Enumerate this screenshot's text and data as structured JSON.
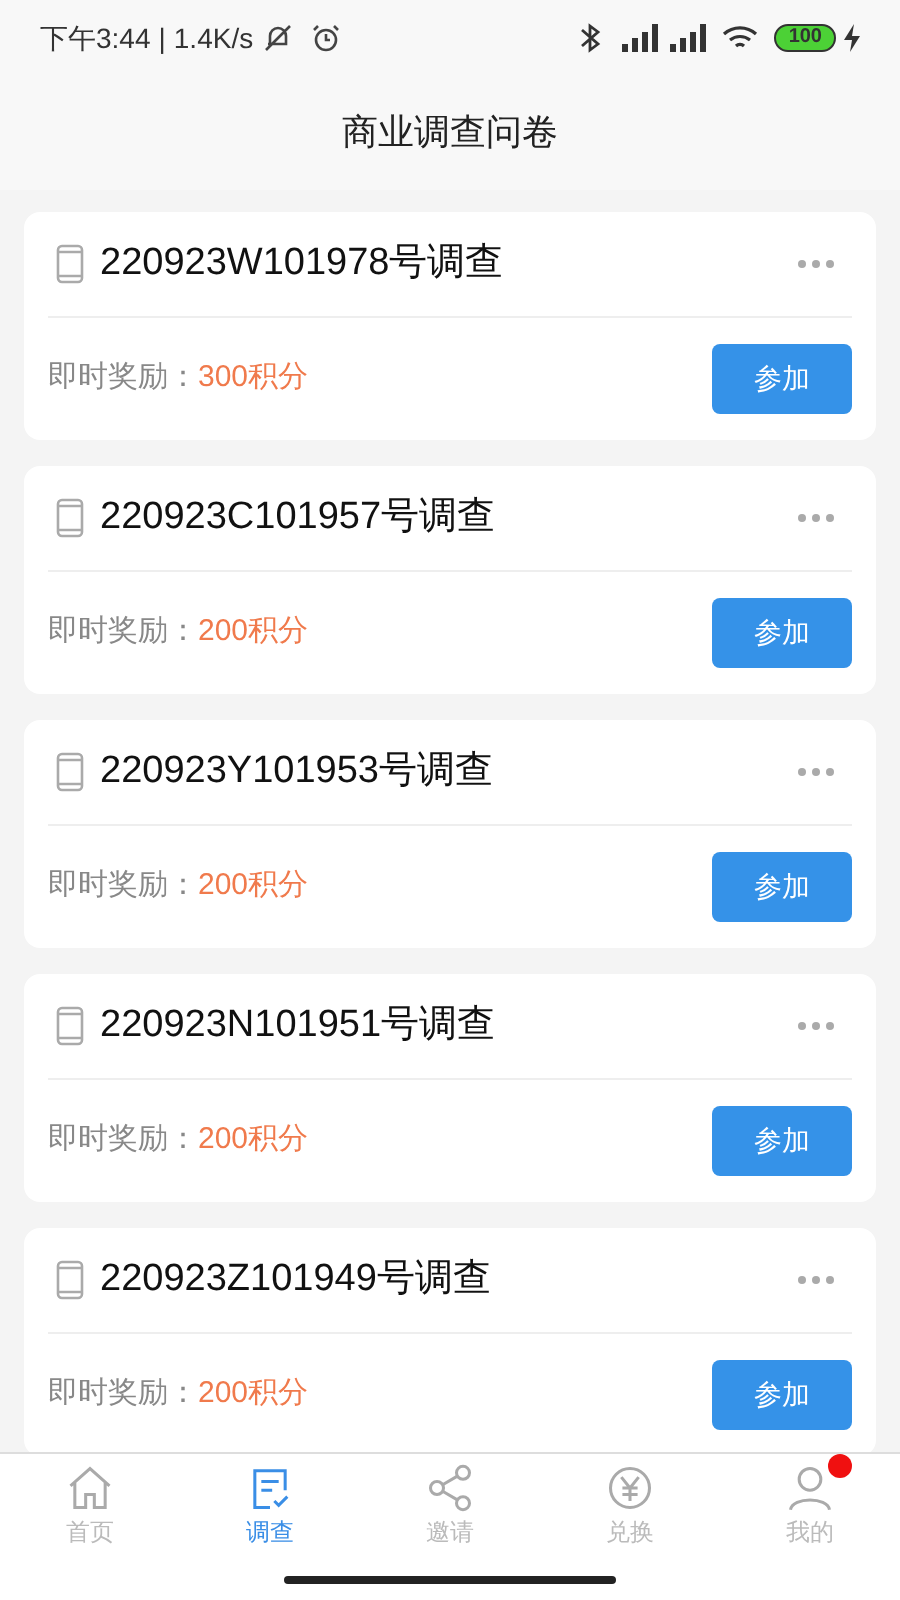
{
  "status_bar": {
    "time": "下午3:44",
    "separator": "|",
    "speed": "1.4K/s",
    "battery": "100"
  },
  "header": {
    "title": "商业调查问卷"
  },
  "surveys": [
    {
      "title": "220923W101978号调查",
      "reward_label": "即时奖励：",
      "reward": "300积分",
      "action": "参加"
    },
    {
      "title": "220923C101957号调查",
      "reward_label": "即时奖励：",
      "reward": "200积分",
      "action": "参加"
    },
    {
      "title": "220923Y101953号调查",
      "reward_label": "即时奖励：",
      "reward": "200积分",
      "action": "参加"
    },
    {
      "title": "220923N101951号调查",
      "reward_label": "即时奖励：",
      "reward": "200积分",
      "action": "参加"
    },
    {
      "title": "220923Z101949号调查",
      "reward_label": "即时奖励：",
      "reward": "200积分",
      "action": "参加"
    }
  ],
  "tab_bar": [
    {
      "label": "首页",
      "kind": "home",
      "selected": false,
      "dot": false
    },
    {
      "label": "调查",
      "kind": "survey",
      "selected": true,
      "dot": false
    },
    {
      "label": "邀请",
      "kind": "share",
      "selected": false,
      "dot": false
    },
    {
      "label": "兑换",
      "kind": "exchange",
      "selected": false,
      "dot": false
    },
    {
      "label": "我的",
      "kind": "profile",
      "selected": false,
      "dot": true
    }
  ]
}
